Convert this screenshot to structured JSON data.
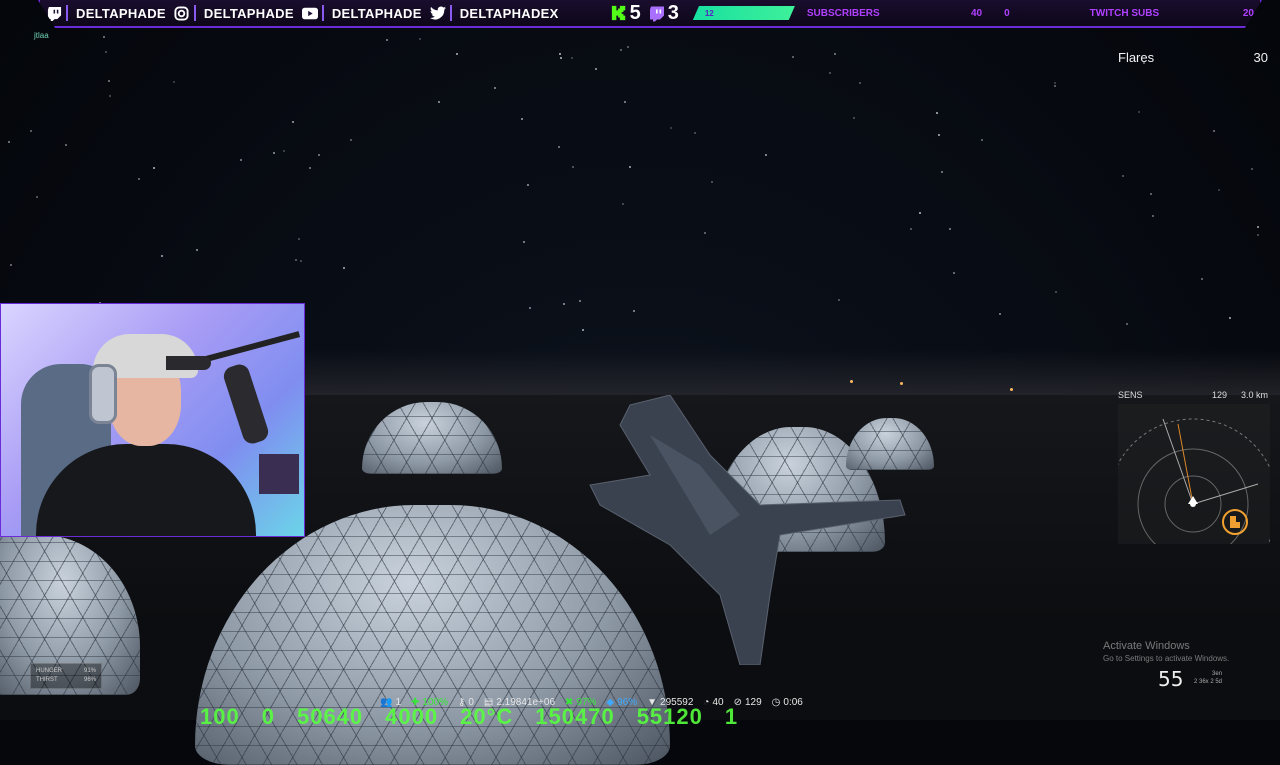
{
  "top_bar": {
    "socials": [
      {
        "icon": "twitch-icon",
        "handle": "DELTAPHADE"
      },
      {
        "icon": "instagram-icon",
        "handle": "DELTAPHADE"
      },
      {
        "icon": "youtube-icon",
        "handle": "DELTAPHADE"
      },
      {
        "icon": "twitter-icon",
        "handle": "DELTAPHADEX"
      }
    ],
    "kick_count": "5",
    "twitch_count": "3",
    "subscribers": {
      "label": "SUBSCRIBERS",
      "current": "12",
      "goal": "40",
      "fraction": 0.3
    },
    "twitch_subs": {
      "label": "TWITCH SUBS",
      "current": "0",
      "goal": "20",
      "fraction": 0.0
    },
    "accent_color": "#6a2bd8",
    "goal_color": "#3ef09a"
  },
  "mini_user": "jtlaa",
  "hud": {
    "flares_label": "Flares",
    "flares_value": "30",
    "radar": {
      "sens_label": "SENS",
      "sens_value": "129",
      "range": "3.0 km"
    },
    "speed": "55",
    "speed_sub": [
      "3en",
      "2 36x 2 5d"
    ],
    "vitals": [
      {
        "label": "HUNGER",
        "value": "91%"
      },
      {
        "label": "THIRST",
        "value": "96%"
      }
    ],
    "bottom": [
      {
        "icon": "players-icon",
        "value": "1"
      },
      {
        "icon": "health-icon",
        "value": "100%"
      },
      {
        "icon": "key-icon",
        "value": "0"
      },
      {
        "icon": "money-icon",
        "value": "2.19841e+06"
      },
      {
        "icon": "tools-icon",
        "value": "97%"
      },
      {
        "icon": "water-icon",
        "value": "96%"
      },
      {
        "icon": "weight-icon",
        "value": "295592"
      },
      {
        "icon": "speedometer-icon",
        "value": "40"
      },
      {
        "icon": "compass-icon",
        "value": "129"
      },
      {
        "icon": "clock-icon",
        "value": "0:06"
      }
    ],
    "big_stats": [
      "100",
      "0",
      "50640",
      "4000",
      "20°C",
      "150470",
      "55120",
      "1"
    ]
  },
  "windows_notice": {
    "title": "Activate Windows",
    "subtitle": "Go to Settings to activate Windows."
  }
}
